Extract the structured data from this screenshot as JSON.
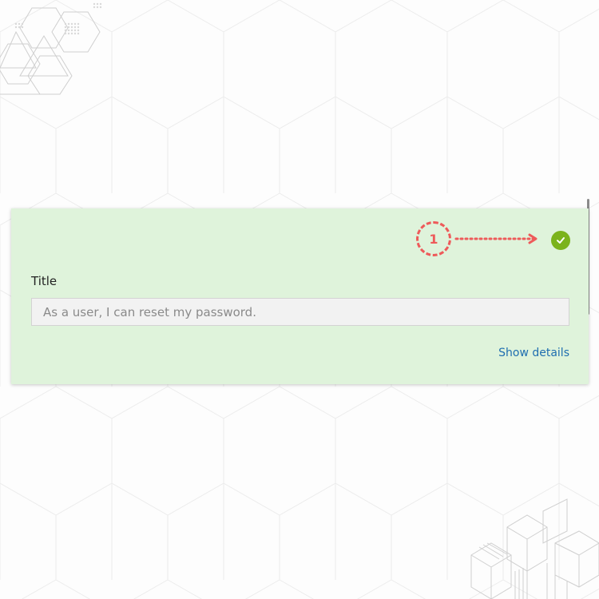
{
  "card": {
    "callout_number": "1",
    "status_icon": "check-circle-icon",
    "title_field": {
      "label": "Title",
      "placeholder": "As a user, I can reset my password.",
      "value": ""
    },
    "show_details_label": "Show details"
  },
  "colors": {
    "card_background": "#dff3db",
    "check_green": "#7bb31b",
    "callout_red": "#ee5a5a",
    "link_blue": "#1f6eb0"
  }
}
